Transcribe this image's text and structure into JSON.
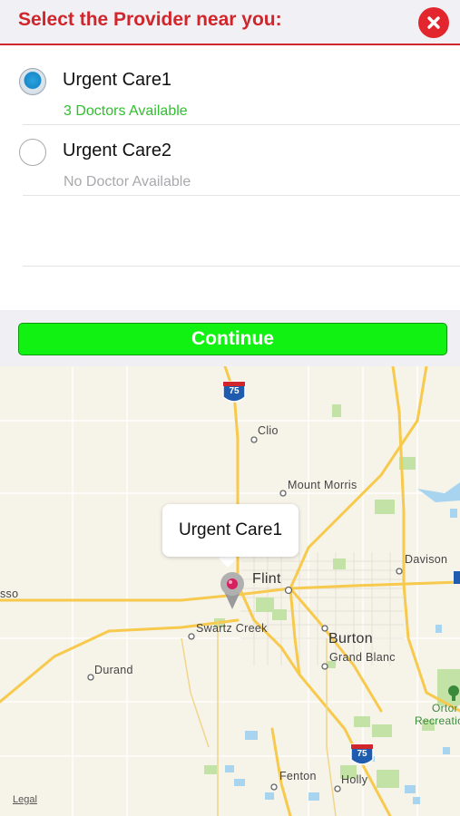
{
  "header": {
    "title": "Select the Provider near you:",
    "close_icon": "close-icon"
  },
  "providers": [
    {
      "name": "Urgent Care1",
      "status": "3 Doctors Available",
      "status_color": "#2fbf2f",
      "selected": true
    },
    {
      "name": "Urgent Care2",
      "status": "No Doctor Available",
      "status_color": "#a9a9ae",
      "selected": false
    }
  ],
  "continue_label": "Continue",
  "map": {
    "callout": "Urgent Care1",
    "highway_shield": "75",
    "legal": "Legal",
    "places": {
      "clio": "Clio",
      "mount_morris": "Mount Morris",
      "flint": "Flint",
      "davison": "Davison",
      "sso": "sso",
      "swartz_creek": "Swartz Creek",
      "burton": "Burton",
      "grand_blanc": "Grand Blanc",
      "durand": "Durand",
      "ortonville": "Ortor",
      "recreation": "Recreatio",
      "fenton": "Fenton",
      "holly": "Holly"
    }
  },
  "colors": {
    "accent": "#d0262b",
    "continue": "#12f212",
    "road": "#f7c94c",
    "water": "#a8d4ef",
    "park": "#c3e3a6"
  }
}
